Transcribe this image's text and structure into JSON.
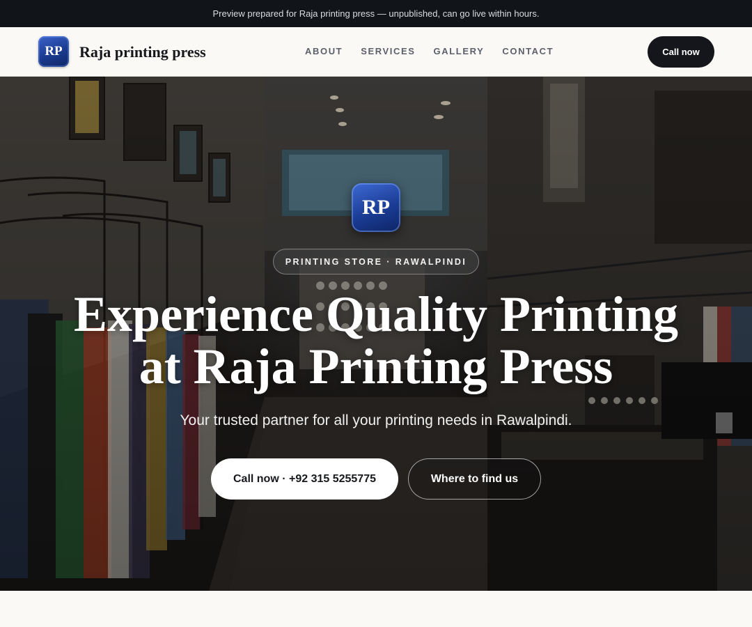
{
  "preview_banner": {
    "text": "Preview prepared for Raja printing press — unpublished, can go live within hours."
  },
  "header": {
    "logo_initials": "RP",
    "brand_name": "Raja printing press",
    "nav": [
      {
        "label": "ABOUT"
      },
      {
        "label": "SERVICES"
      },
      {
        "label": "GALLERY"
      },
      {
        "label": "CONTACT"
      }
    ],
    "call_label": "Call now"
  },
  "hero": {
    "badge_initials": "RP",
    "tagline": "PRINTING STORE · RAWALPINDI",
    "title_line1": "Experience Quality Printing",
    "title_line2": "at Raja Printing Press",
    "subtitle": "Your trusted partner for all your printing needs in Rawalpindi.",
    "primary_button": "Call now · +92 315 5255775",
    "secondary_button": "Where to find us",
    "background": "store interior photo"
  },
  "colors": {
    "topbar_bg": "#111418",
    "nav_bg": "#faf9f6",
    "brand_blue": "#1a3a8f",
    "dark_button": "#14161b"
  }
}
